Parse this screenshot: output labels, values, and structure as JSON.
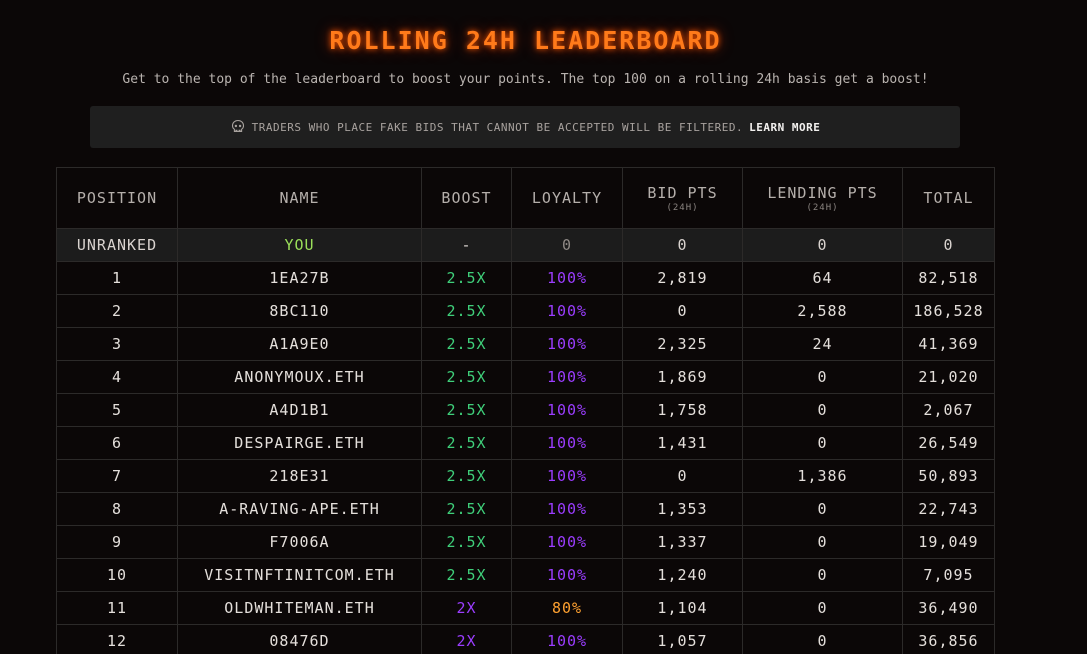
{
  "header": {
    "title": "ROLLING 24H LEADERBOARD",
    "subtitle": "Get to the top of the leaderboard to boost your points. The top 100 on a rolling 24h basis get a boost!"
  },
  "notice": {
    "icon": "skull-icon",
    "text": "TRADERS WHO PLACE FAKE BIDS THAT CANNOT BE ACCEPTED WILL BE FILTERED.",
    "link_label": "LEARN MORE"
  },
  "table": {
    "columns": [
      {
        "label": "POSITION",
        "sub": ""
      },
      {
        "label": "NAME",
        "sub": ""
      },
      {
        "label": "BOOST",
        "sub": ""
      },
      {
        "label": "LOYALTY",
        "sub": ""
      },
      {
        "label": "BID PTS",
        "sub": "(24H)"
      },
      {
        "label": "LENDING PTS",
        "sub": "(24H)"
      },
      {
        "label": "TOTAL",
        "sub": ""
      }
    ],
    "you_row": {
      "position": "UNRANKED",
      "name": "YOU",
      "boost": "-",
      "loyalty": "0",
      "bid_pts": "0",
      "lending_pts": "0",
      "total": "0"
    },
    "rows": [
      {
        "position": "1",
        "name": "1EA27B",
        "boost": "2.5X",
        "loyalty": "100%",
        "bid_pts": "2,819",
        "lending_pts": "64",
        "total": "82,518"
      },
      {
        "position": "2",
        "name": "8BC110",
        "boost": "2.5X",
        "loyalty": "100%",
        "bid_pts": "0",
        "lending_pts": "2,588",
        "total": "186,528"
      },
      {
        "position": "3",
        "name": "A1A9E0",
        "boost": "2.5X",
        "loyalty": "100%",
        "bid_pts": "2,325",
        "lending_pts": "24",
        "total": "41,369"
      },
      {
        "position": "4",
        "name": "ANONYMOUX.ETH",
        "boost": "2.5X",
        "loyalty": "100%",
        "bid_pts": "1,869",
        "lending_pts": "0",
        "total": "21,020"
      },
      {
        "position": "5",
        "name": "A4D1B1",
        "boost": "2.5X",
        "loyalty": "100%",
        "bid_pts": "1,758",
        "lending_pts": "0",
        "total": "2,067"
      },
      {
        "position": "6",
        "name": "DESPAIRGE.ETH",
        "boost": "2.5X",
        "loyalty": "100%",
        "bid_pts": "1,431",
        "lending_pts": "0",
        "total": "26,549"
      },
      {
        "position": "7",
        "name": "218E31",
        "boost": "2.5X",
        "loyalty": "100%",
        "bid_pts": "0",
        "lending_pts": "1,386",
        "total": "50,893"
      },
      {
        "position": "8",
        "name": "A-RAVING-APE.ETH",
        "boost": "2.5X",
        "loyalty": "100%",
        "bid_pts": "1,353",
        "lending_pts": "0",
        "total": "22,743"
      },
      {
        "position": "9",
        "name": "F7006A",
        "boost": "2.5X",
        "loyalty": "100%",
        "bid_pts": "1,337",
        "lending_pts": "0",
        "total": "19,049"
      },
      {
        "position": "10",
        "name": "VISITNFTINITCOM.ETH",
        "boost": "2.5X",
        "loyalty": "100%",
        "bid_pts": "1,240",
        "lending_pts": "0",
        "total": "7,095"
      },
      {
        "position": "11",
        "name": "OLDWHITEMAN.ETH",
        "boost": "2X",
        "loyalty": "80%",
        "bid_pts": "1,104",
        "lending_pts": "0",
        "total": "36,490"
      },
      {
        "position": "12",
        "name": "08476D",
        "boost": "2X",
        "loyalty": "100%",
        "bid_pts": "1,057",
        "lending_pts": "0",
        "total": "36,856"
      }
    ]
  },
  "colors": {
    "title": "#ff7a1a",
    "boost_2_5x": "#3fcf7a",
    "boost_2x": "#9b3dff",
    "loyalty_100": "#9b3dff",
    "loyalty_80": "#ffa130",
    "you": "#9be05a"
  }
}
